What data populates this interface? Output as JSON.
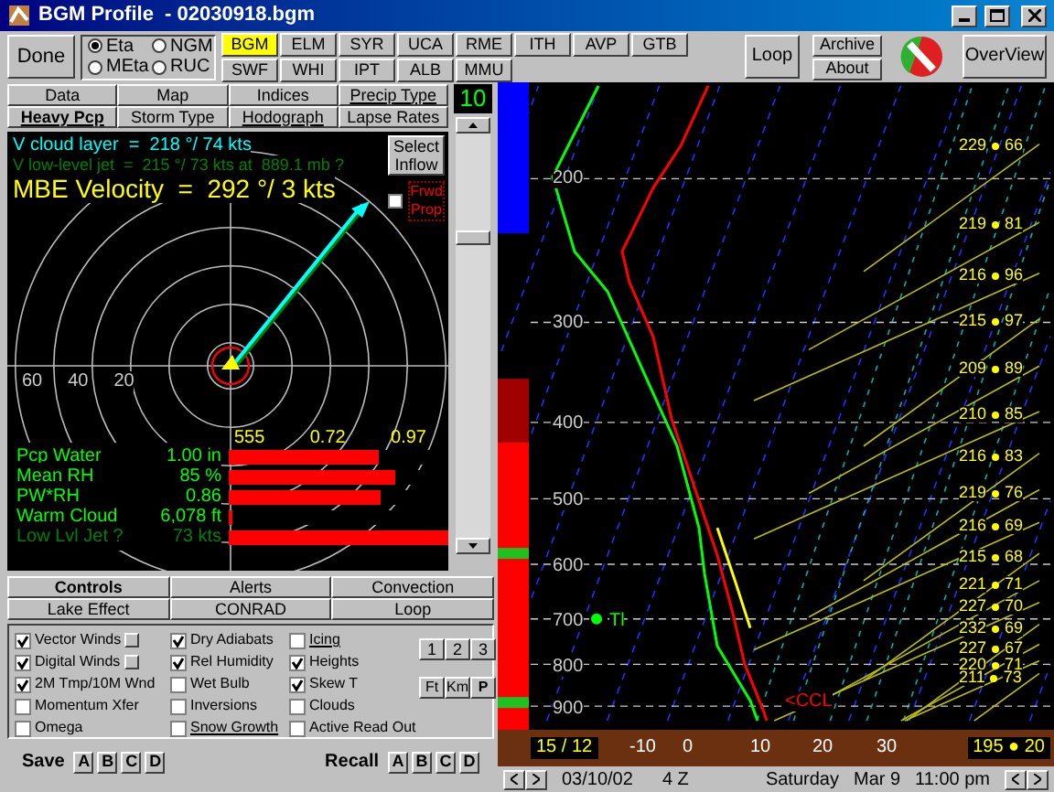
{
  "window": {
    "title": "BGM Profile  - 02030918.bgm"
  },
  "toolbar": {
    "done": "Done",
    "models": [
      {
        "label": "Eta",
        "selected": true
      },
      {
        "label": "NGM",
        "selected": false
      },
      {
        "label": "MEta",
        "selected": false
      },
      {
        "label": "RUC",
        "selected": false
      }
    ],
    "stations": [
      {
        "label": "BGM",
        "selected": true
      },
      {
        "label": "ELM",
        "selected": false
      },
      {
        "label": "SYR",
        "selected": false
      },
      {
        "label": "UCA",
        "selected": false
      },
      {
        "label": "RME",
        "selected": false
      },
      {
        "label": "ITH",
        "selected": false
      },
      {
        "label": "AVP",
        "selected": false
      },
      {
        "label": "GTB",
        "selected": false
      },
      {
        "label": "SWF",
        "selected": false
      },
      {
        "label": "WHI",
        "selected": false
      },
      {
        "label": "IPT",
        "selected": false
      },
      {
        "label": "ALB",
        "selected": false
      },
      {
        "label": "MMU",
        "selected": false
      }
    ],
    "loop": "Loop",
    "archive": "Archive",
    "about": "About",
    "overview": "OverView"
  },
  "view_tabs": [
    {
      "label": "Data",
      "selected": false,
      "underlined": false
    },
    {
      "label": "Map",
      "selected": false,
      "underlined": false
    },
    {
      "label": "Indices",
      "selected": false,
      "underlined": false
    },
    {
      "label": "Precip Type",
      "selected": false,
      "underlined": true
    },
    {
      "label": "Heavy Pcp",
      "selected": true,
      "underlined": true
    },
    {
      "label": "Storm Type",
      "selected": false,
      "underlined": false
    },
    {
      "label": "Hodograph",
      "selected": false,
      "underlined": true
    },
    {
      "label": "Lapse Rates",
      "selected": false,
      "underlined": false
    }
  ],
  "counter": "10",
  "hodograph": {
    "cloud_layer": "V cloud layer  =  218 °/ 74 kts",
    "low_level_jet": "V low-level jet  =  215 °/ 73 kts at  889.1 mb ?",
    "mbe_velocity": "MBE Velocity  =  292 °/ 3 kts",
    "select_inflow": "Select Inflow",
    "forward_prop": {
      "label": "Frwd Prop",
      "checked": false
    },
    "ring_labels": [
      "60",
      "40",
      "20"
    ]
  },
  "heavy_pcp": {
    "scale_labels": [
      "555",
      "0.72",
      "0.97"
    ],
    "rows": [
      {
        "label": "Pcp Water",
        "value": "1.00 in",
        "level": 0.68,
        "dim": false
      },
      {
        "label": "Mean RH",
        "value": "85 %",
        "level": 0.76,
        "dim": false
      },
      {
        "label": "PW*RH",
        "value": "0.86",
        "level": 0.69,
        "dim": false
      },
      {
        "label": "Warm Cloud",
        "value": "6,078 ft",
        "level": 0.02,
        "dim": false
      },
      {
        "label": "Low Lvl Jet ?",
        "value": "73 kts",
        "level": 1.0,
        "dim": true
      }
    ]
  },
  "control_tabs": [
    {
      "label": "Controls",
      "selected": true
    },
    {
      "label": "Alerts",
      "selected": false
    },
    {
      "label": "Convection",
      "selected": false
    },
    {
      "label": "Lake Effect",
      "selected": false
    },
    {
      "label": "CONRAD",
      "selected": false
    },
    {
      "label": "Loop",
      "selected": false
    }
  ],
  "options": [
    [
      {
        "label": "Vector Winds",
        "checked": true,
        "underlined": false,
        "extra_button": true
      },
      {
        "label": "Digital Winds",
        "checked": true,
        "underlined": false,
        "extra_button": true
      },
      {
        "label": "2M Tmp/10M Wnd",
        "checked": true,
        "underlined": false,
        "extra_button": false
      },
      {
        "label": "Momentum Xfer",
        "checked": false,
        "underlined": false,
        "extra_button": false
      },
      {
        "label": "Omega",
        "checked": false,
        "underlined": false,
        "extra_button": false
      }
    ],
    [
      {
        "label": "Dry Adiabats",
        "checked": true,
        "underlined": false,
        "extra_button": false
      },
      {
        "label": "Rel Humidity",
        "checked": true,
        "underlined": false,
        "extra_button": false
      },
      {
        "label": "Wet Bulb",
        "checked": false,
        "underlined": false,
        "extra_button": false
      },
      {
        "label": "Inversions",
        "checked": false,
        "underlined": false,
        "extra_button": false
      },
      {
        "label": "Snow Growth",
        "checked": false,
        "underlined": true,
        "extra_button": false
      }
    ],
    [
      {
        "label": "Icing",
        "checked": false,
        "underlined": true,
        "extra_button": false
      },
      {
        "label": "Heights",
        "checked": true,
        "underlined": false,
        "extra_button": false
      },
      {
        "label": "Skew T",
        "checked": true,
        "underlined": false,
        "extra_button": false
      },
      {
        "label": "Clouds",
        "checked": false,
        "underlined": false,
        "extra_button": false
      },
      {
        "label": "Active Read Out",
        "checked": false,
        "underlined": false,
        "extra_button": false
      }
    ]
  ],
  "panel_buttons": [
    {
      "label": "1",
      "bold": false
    },
    {
      "label": "2",
      "bold": false
    },
    {
      "label": "3",
      "bold": false
    }
  ],
  "unit_buttons": [
    {
      "label": "Ft",
      "bold": false
    },
    {
      "label": "Km",
      "bold": false
    },
    {
      "label": "P",
      "bold": true
    }
  ],
  "save": {
    "label": "Save",
    "slots": [
      "A",
      "B",
      "C",
      "D"
    ]
  },
  "recall": {
    "label": "Recall",
    "slots": [
      "A",
      "B",
      "C",
      "D"
    ]
  },
  "sounding": {
    "pressure_labels": [
      "200",
      "300",
      "400",
      "500",
      "600",
      "700",
      "800",
      "900"
    ],
    "temperature_labels": [
      "-10",
      "0",
      "10",
      "20",
      "30"
    ],
    "surface_readout": "15 / 12",
    "surface_wind": "195 ● 20",
    "ccl": "<CCL",
    "marker": "Tl",
    "winds": [
      {
        "direction": "229",
        "speed": "66"
      },
      {
        "direction": "219",
        "speed": "81"
      },
      {
        "direction": "216",
        "speed": "96"
      },
      {
        "direction": "215",
        "speed": "97"
      },
      {
        "direction": "209",
        "speed": "89"
      },
      {
        "direction": "210",
        "speed": "85"
      },
      {
        "direction": "216",
        "speed": "83"
      },
      {
        "direction": "219",
        "speed": "76"
      },
      {
        "direction": "216",
        "speed": "69"
      },
      {
        "direction": "215",
        "speed": "68"
      },
      {
        "direction": "221",
        "speed": "71"
      },
      {
        "direction": "227",
        "speed": "70"
      },
      {
        "direction": "232",
        "speed": "69"
      },
      {
        "direction": "227",
        "speed": "67"
      },
      {
        "direction": "220",
        "speed": "71"
      },
      {
        "direction": "211",
        "speed": "73"
      }
    ]
  },
  "status_bar": {
    "date": "03/10/02",
    "zulu": "4 Z",
    "day": "Saturday",
    "local_date": "Mar 9",
    "local_time": "11:00 pm"
  }
}
